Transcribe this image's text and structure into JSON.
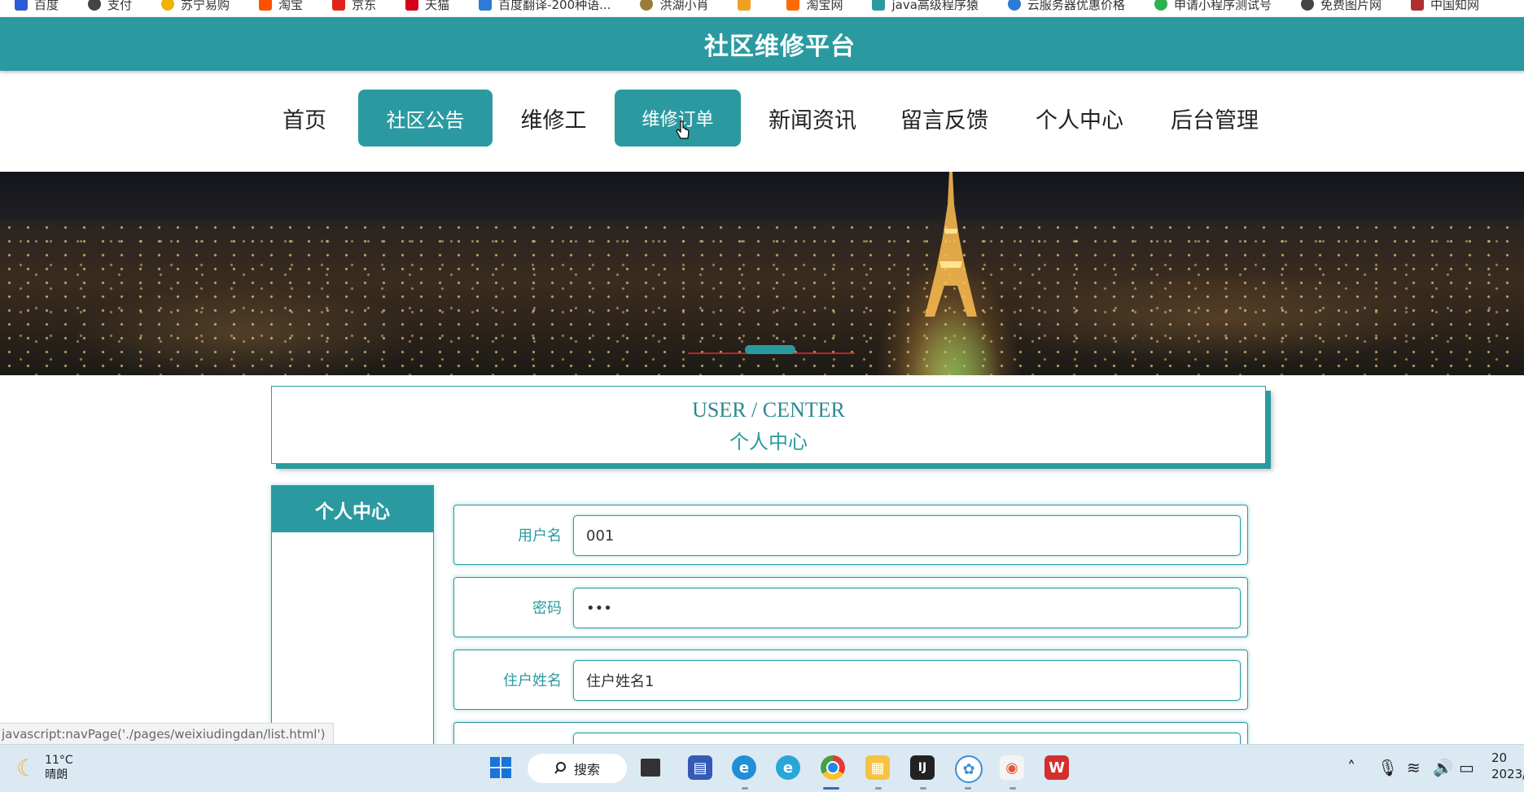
{
  "bookmarks": [
    {
      "label": "百度",
      "icon": "baidu-icon",
      "color": "#2b5bd7"
    },
    {
      "label": "支付",
      "icon": "pay-icon",
      "color": "#444444"
    },
    {
      "label": "苏宁易购",
      "icon": "suning-icon",
      "color": "#f0b400"
    },
    {
      "label": "淘宝",
      "icon": "taobao-icon",
      "color": "#ff5000"
    },
    {
      "label": "京东",
      "icon": "jd-icon",
      "color": "#e1251b"
    },
    {
      "label": "天猫",
      "icon": "tmall-icon",
      "color": "#d4001a"
    },
    {
      "label": "百度翻译-200种语...",
      "icon": "translate-icon",
      "color": "#2b7bd7"
    },
    {
      "label": "洪湖小肖",
      "icon": "bookmark-icon",
      "color": "#9a7b3b"
    },
    {
      "label": "",
      "icon": "bookmark-icon",
      "color": "#f0a020"
    },
    {
      "label": "淘宝网",
      "icon": "taobao-icon",
      "color": "#ff6a00"
    },
    {
      "label": "java高级程序猿",
      "icon": "bookmark-icon",
      "color": "#2b9aa0"
    },
    {
      "label": "云服务器优惠价格",
      "icon": "cloud-icon",
      "color": "#2b7bd7"
    },
    {
      "label": "申请小程序测试号",
      "icon": "wechat-icon",
      "color": "#2bb24c"
    },
    {
      "label": "免费图片网",
      "icon": "bookmark-icon",
      "color": "#444444"
    },
    {
      "label": "中国知网",
      "icon": "cnki-icon",
      "color": "#b03030"
    }
  ],
  "header": {
    "title": "社区维修平台"
  },
  "nav": {
    "items": [
      "首页",
      "社区公告",
      "维修工",
      "维修订单",
      "新闻资讯",
      "留言反馈",
      "个人中心",
      "后台管理"
    ]
  },
  "page": {
    "title_en": "USER / CENTER",
    "title_cn": "个人中心"
  },
  "sidebar": {
    "heading": "个人中心"
  },
  "form": {
    "fields": [
      {
        "label": "用户名",
        "value": "001"
      },
      {
        "label": "密码",
        "value": "•••"
      },
      {
        "label": "住户姓名",
        "value": "住户姓名1"
      },
      {
        "label": "",
        "value": ""
      }
    ]
  },
  "status_url": "javascript:navPage('./pages/weixiudingdan/list.html')",
  "taskbar": {
    "temperature": "11°C",
    "weather": "晴朗",
    "search_label": "搜索",
    "clock_time": "20",
    "clock_date": "2023/"
  },
  "colors": {
    "accent": "#2b9aa0"
  }
}
